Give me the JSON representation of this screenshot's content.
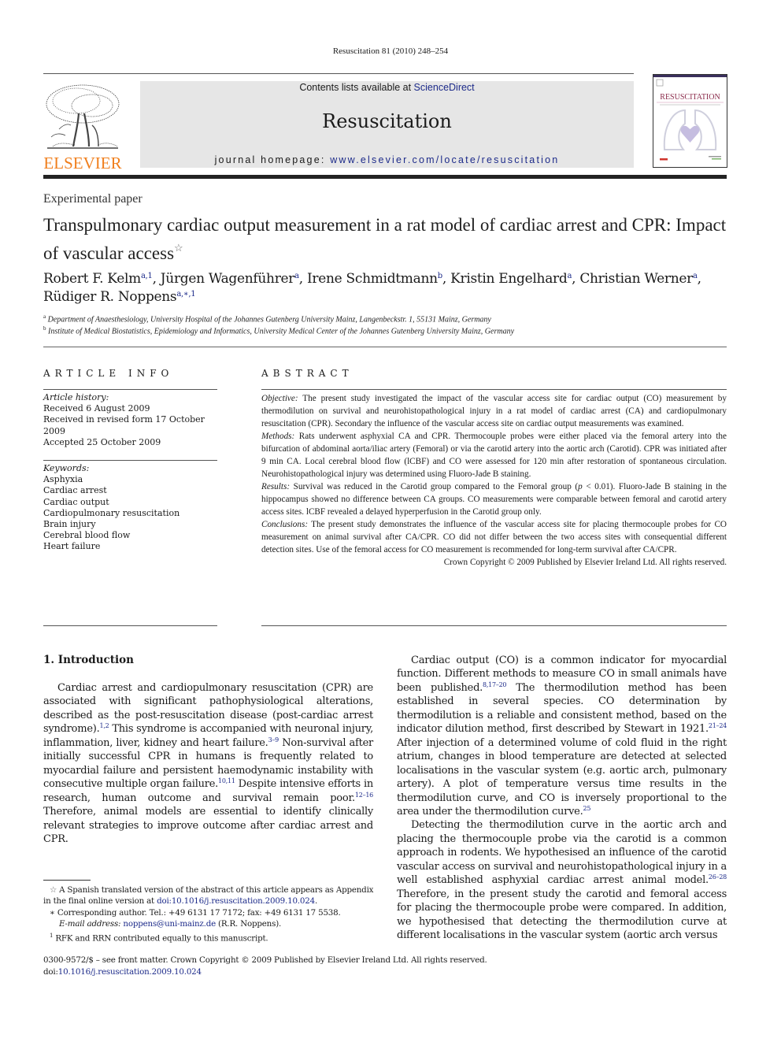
{
  "running_head": "Resuscitation 81 (2010) 248–254",
  "masthead": {
    "publisher_logo": "ELSEVIER",
    "contents_prefix": "Contents lists available at ",
    "contents_link": "ScienceDirect",
    "journal_name": "Resuscitation",
    "homepage_prefix": "journal homepage: ",
    "homepage_link": "www.elsevier.com/locate/resuscitation",
    "cover_title": "RESUSCITATION",
    "colors": {
      "publisher_orange": "#f07f1d",
      "link_blue": "#1d2b8a",
      "box_gray": "#e6e6e6"
    }
  },
  "article": {
    "type": "Experimental paper",
    "title": "Transpulmonary cardiac output measurement in a rat model of cardiac arrest and CPR: Impact of vascular access",
    "title_mark": "☆",
    "authors": [
      {
        "name": "Robert F. Kelm",
        "sup": "a,1",
        "sep": ", "
      },
      {
        "name": "Jürgen Wagenführer",
        "sup": "a",
        "sep": ", "
      },
      {
        "name": "Irene Schmidtmann",
        "sup": "b",
        "sep": ", "
      },
      {
        "name": "Kristin Engelhard",
        "sup": "a",
        "sep": ", "
      },
      {
        "name": "Christian Werner",
        "sup": "a",
        "sep": ", "
      },
      {
        "name": "Rüdiger R. Noppens",
        "sup": "a,∗,1",
        "sep": ""
      }
    ],
    "affiliations": [
      {
        "mark": "a",
        "text": "Department of Anaesthesiology, University Hospital of the Johannes Gutenberg University Mainz, Langenbeckstr. 1, 55131 Mainz, Germany"
      },
      {
        "mark": "b",
        "text": "Institute of Medical Biostatistics, Epidemiology and Informatics, University Medical Center of the Johannes Gutenberg University Mainz, Germany"
      }
    ]
  },
  "article_info": {
    "heading": "ARTICLE INFO",
    "history_label": "Article history:",
    "history": [
      "Received 6 August 2009",
      "Received in revised form 17 October 2009",
      "Accepted 25 October 2009"
    ],
    "keywords_label": "Keywords:",
    "keywords": [
      "Asphyxia",
      "Cardiac arrest",
      "Cardiac output",
      "Cardiopulmonary resuscitation",
      "Brain injury",
      "Cerebral blood flow",
      "Heart failure"
    ]
  },
  "abstract": {
    "heading": "ABSTRACT",
    "sections": [
      {
        "label": "Objective:",
        "text": " The present study investigated the impact of the vascular access site for cardiac output (CO) measurement by thermodilution on survival and neurohistopathological injury in a rat model of cardiac arrest (CA) and cardiopulmonary resuscitation (CPR). Secondary the influence of the vascular access site on cardiac output measurements was examined."
      },
      {
        "label": "Methods:",
        "text": " Rats underwent asphyxial CA and CPR. Thermocouple probes were either placed via the femoral artery into the bifurcation of abdominal aorta/iliac artery (Femoral) or via the carotid artery into the aortic arch (Carotid). CPR was initiated after 9 min CA. Local cerebral blood flow (lCBF) and CO were assessed for 120 min after restoration of spontaneous circulation. Neurohistopathological injury was determined using Fluoro-Jade B staining."
      },
      {
        "label": "Results:",
        "text_before_p": " Survival was reduced in the Carotid group compared to the Femoral group (",
        "p_symbol": "p",
        "text": " < 0.01). Fluoro-Jade B staining in the hippocampus showed no difference between CA groups. CO measurements were comparable between femoral and carotid artery access sites. lCBF revealed a delayed hyperperfusion in the Carotid group only."
      },
      {
        "label": "Conclusions:",
        "text": " The present study demonstrates the influence of the vascular access site for placing thermocouple probes for CO measurement on animal survival after CA/CPR. CO did not differ between the two access sites with consequential different detection sites. Use of the femoral access for CO measurement is recommended for long-term survival after CA/CPR."
      }
    ],
    "copyright": "Crown Copyright © 2009 Published by Elsevier Ireland Ltd. All rights reserved."
  },
  "body": {
    "section_heading": "1.  Introduction",
    "left_paragraph": [
      {
        "t": "Cardiac arrest and cardiopulmonary resuscitation (CPR) are associated with significant pathophysiological alterations, described as the post-resuscitation disease (post-cardiac arrest syndrome)."
      },
      {
        "ref": "1,2"
      },
      {
        "t": " This syndrome is accompanied with neuronal injury, inflammation, liver, kidney and heart failure."
      },
      {
        "ref": "3–9"
      },
      {
        "t": " Non-survival after initially successful CPR in humans is frequently related to myocardial failure and persistent haemodynamic instability with consecutive multiple organ failure."
      },
      {
        "ref": "10,11"
      },
      {
        "t": " Despite intensive efforts in research, human outcome and survival remain poor."
      },
      {
        "ref": "12–16"
      },
      {
        "t": " Therefore, animal models are essential to identify clinically relevant strategies to improve outcome after cardiac arrest and CPR."
      }
    ],
    "right_paragraph_1": [
      {
        "t": "Cardiac output (CO) is a common indicator for myocardial function. Different methods to measure CO in small animals have been published."
      },
      {
        "ref": "8,17–20"
      },
      {
        "t": " The thermodilution method has been established in several species. CO determination by thermodilution is a reliable and consistent method, based on the indicator dilution method, first described by Stewart in 1921."
      },
      {
        "ref": "21–24"
      },
      {
        "t": " After injection of a determined volume of cold fluid in the right atrium, changes in blood temperature are detected at selected localisations in the vascular system (e.g. aortic arch, pulmonary artery). A plot of temperature versus time results in the thermodilution curve, and CO is inversely proportional to the area under the thermodilution curve."
      },
      {
        "ref": "25"
      }
    ],
    "right_paragraph_2": [
      {
        "t": "Detecting the thermodilution curve in the aortic arch and placing the thermocouple probe via the carotid is a common approach in rodents. We hypothesised an influence of the carotid vascular access on survival and neurohistopathological injury in a well established asphyxial cardiac arrest animal model."
      },
      {
        "ref": "26–28"
      },
      {
        "t": " Therefore, in the present study the carotid and femoral access for placing the thermocouple probe were compared. In addition, we hypothesised that detecting the thermodilution curve at different localisations in the vascular system (aortic arch versus"
      }
    ]
  },
  "footnotes": {
    "star_mark": "☆",
    "star_text": " A Spanish translated version of the abstract of this article appears as Appendix in the final online version at ",
    "star_link": "doi:10.1016/j.resuscitation.2009.10.024",
    "star_end": ".",
    "corr_mark": "∗",
    "corr_text": " Corresponding author. Tel.: +49 6131 17 7172; fax: +49 6131 17 5538.",
    "email_label": "E-mail address:",
    "email": "noppens@uni-mainz.de",
    "email_after": " (R.R. Noppens).",
    "one_mark": "1",
    "one_text": " RFK and RRN contributed equally to this manuscript."
  },
  "bottom": {
    "issn_line": "0300-9572/$ – see front matter. Crown Copyright © 2009 Published by Elsevier Ireland Ltd. All rights reserved.",
    "doi_prefix": "doi:",
    "doi_link": "10.1016/j.resuscitation.2009.10.024"
  }
}
